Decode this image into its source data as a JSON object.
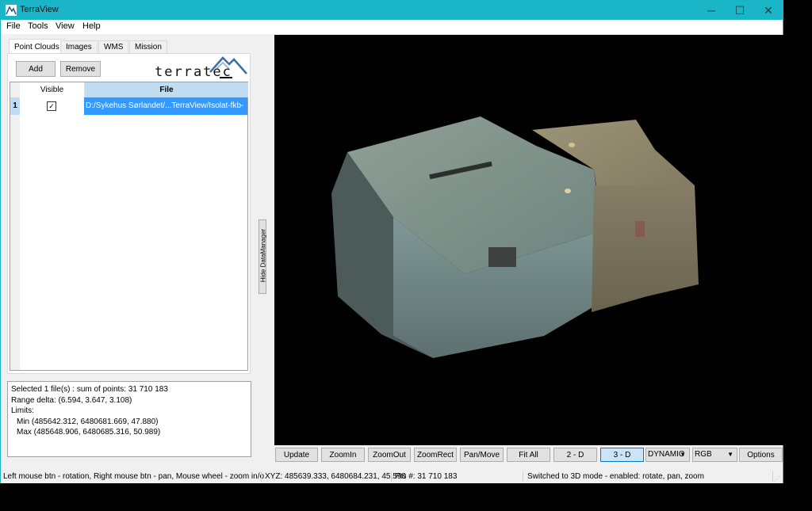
{
  "window": {
    "title": "TerraView",
    "controls": {
      "minimize": "─",
      "maximize": "☐",
      "close": "✕"
    }
  },
  "menu": [
    "File",
    "Tools",
    "View",
    "Help"
  ],
  "data_manager": {
    "tabs": [
      {
        "label": "Point Clouds",
        "active": true
      },
      {
        "label": "Images",
        "active": false
      },
      {
        "label": "WMS",
        "active": false
      },
      {
        "label": "Mission",
        "active": false
      }
    ],
    "add_label": "Add",
    "remove_label": "Remove",
    "logo_text": "terratec",
    "table": {
      "columns": [
        "Visible",
        "File"
      ],
      "rows": [
        {
          "index": "1",
          "visible": true,
          "file": "D:/Sykehus Sørlandet/...TerraView/Isolat-fkb-"
        }
      ]
    },
    "info": {
      "line1": "Selected 1 file(s) : sum of points: 31 710 183",
      "line2": "Range delta: (6.594, 3.647, 3.108)",
      "line3": "Limits:",
      "line4": "Min (485642.312, 6480681.669, 47.880)",
      "line5": "Max (485648.906, 6480685.316, 50.989)"
    },
    "hide_label": "Hide DataManager"
  },
  "toolbar": {
    "buttons": [
      "Update",
      "ZoomIn",
      "ZoomOut",
      "ZoomRect",
      "Pan/Move",
      "Fit All",
      "2 - D",
      "3 - D"
    ],
    "active_button": "3 - D",
    "mode_select": "DYNAMIC",
    "color_select": "RGB",
    "options_label": "Options"
  },
  "statusbar": {
    "hint": "Left mouse btn - rotation, Right mouse btn - pan, Mouse wheel - zoom in/o",
    "xyz": "XYZ: 485639.333, 6480684.231, 45.590",
    "pts": "Pts #: 31 710 183",
    "message": "Switched to 3D mode - enabled: rotate, pan, zoom"
  },
  "colors": {
    "titlebar": "#1ab5c6",
    "selection": "#3399ff",
    "active_button": "#cce4f7"
  }
}
